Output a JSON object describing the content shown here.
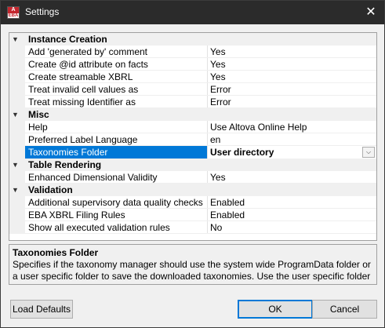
{
  "window": {
    "title": "Settings",
    "icon_top": "A",
    "icon_bottom": "EBA",
    "close_glyph": "✕"
  },
  "grid": {
    "expand_glyph": "▼",
    "dropdown_glyph": "⌵",
    "selected_color": "#0078d7",
    "categories": [
      {
        "label": "Instance Creation",
        "items": [
          {
            "name": "Add 'generated by' comment",
            "value": "Yes"
          },
          {
            "name": "Create @id attribute on facts",
            "value": "Yes"
          },
          {
            "name": "Create streamable XBRL",
            "value": "Yes"
          },
          {
            "name": "Treat invalid cell values as",
            "value": "Error"
          },
          {
            "name": "Treat missing Identifier as",
            "value": "Error"
          }
        ]
      },
      {
        "label": "Misc",
        "items": [
          {
            "name": "Help",
            "value": "Use Altova Online Help"
          },
          {
            "name": "Preferred Label Language",
            "value": "en"
          },
          {
            "name": "Taxonomies Folder",
            "value": "User directory"
          }
        ]
      },
      {
        "label": "Table Rendering",
        "items": [
          {
            "name": "Enhanced Dimensional Validity",
            "value": "Yes"
          }
        ]
      },
      {
        "label": "Validation",
        "items": [
          {
            "name": "Additional supervisory data quality checks",
            "value": "Enabled"
          },
          {
            "name": "EBA XBRL Filing Rules",
            "value": "Enabled"
          },
          {
            "name": "Show all executed validation rules",
            "value": "No"
          }
        ]
      }
    ]
  },
  "description": {
    "title": "Taxonomies Folder",
    "text": "Specifies if the taxonomy manager should use the system wide ProgramData folder or a user specific folder to save the downloaded taxonomies. Use the user specific folder if you..."
  },
  "buttons": {
    "load_defaults": "Load Defaults",
    "ok": "OK",
    "cancel": "Cancel"
  }
}
